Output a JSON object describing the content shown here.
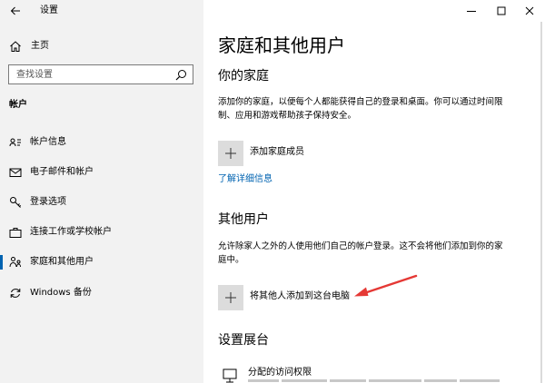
{
  "window": {
    "title": "设置",
    "controls": {
      "minimize": "minimize-icon",
      "maximize": "maximize-icon",
      "close": "close-icon"
    }
  },
  "sidebar": {
    "home_label": "主页",
    "search_placeholder": "查找设置",
    "section_title": "帐户",
    "items": [
      {
        "label": "帐户信息",
        "icon": "person-card-icon",
        "active": false
      },
      {
        "label": "电子邮件和帐户",
        "icon": "mail-icon",
        "active": false
      },
      {
        "label": "登录选项",
        "icon": "key-icon",
        "active": false
      },
      {
        "label": "连接工作或学校帐户",
        "icon": "briefcase-icon",
        "active": false
      },
      {
        "label": "家庭和其他用户",
        "icon": "family-icon",
        "active": true
      },
      {
        "label": "Windows 备份",
        "icon": "sync-icon",
        "active": false
      }
    ]
  },
  "main": {
    "title": "家庭和其他用户",
    "family": {
      "heading": "你的家庭",
      "description": "添加你的家庭，以便每个人都能获得自己的登录和桌面。你可以通过时间限制、应用和游戏帮助孩子保持安全。",
      "add_label": "添加家庭成员",
      "learn_more": "了解详细信息"
    },
    "others": {
      "heading": "其他用户",
      "description": "允许除家人之外的人使用他们自己的帐户登录。这不会将他们添加到你的家庭中。",
      "add_label": "将其他人添加到这台电脑"
    },
    "kiosk": {
      "heading": "设置展台",
      "item_label": "分配的访问权限"
    }
  },
  "colors": {
    "accent": "#0063b1",
    "annotation_arrow": "#e53935",
    "sidebar_bg": "#f2f2f2"
  }
}
